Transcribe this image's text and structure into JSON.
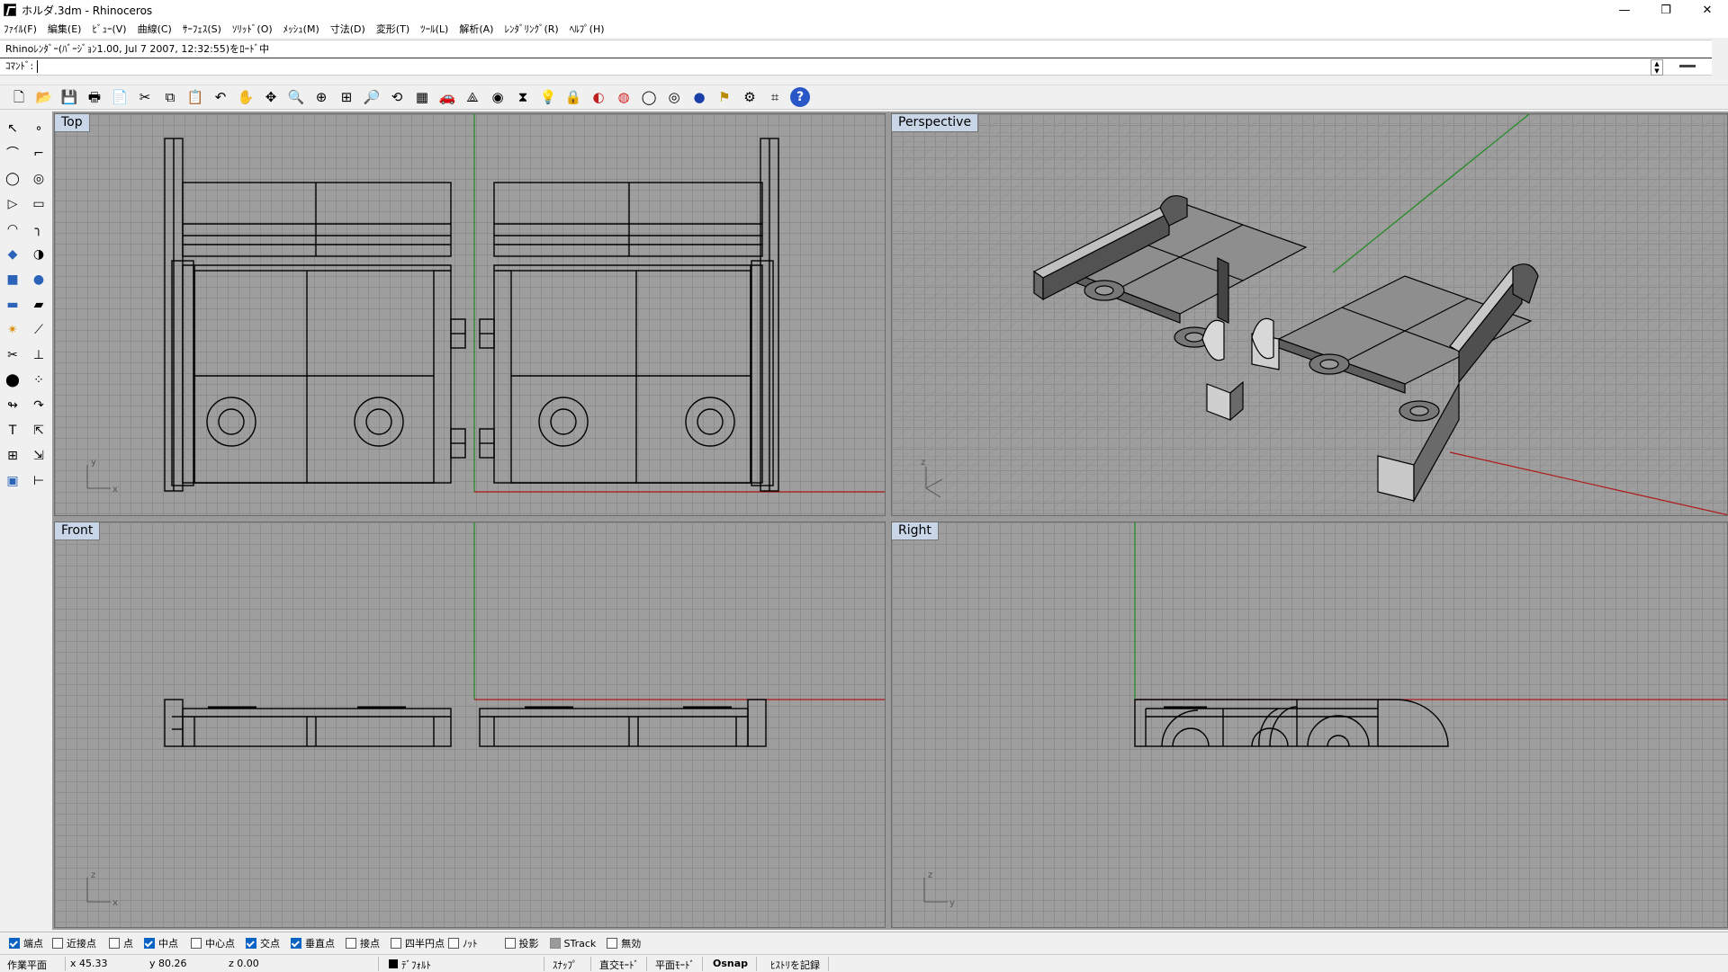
{
  "window": {
    "title": "ホルダ.3dm - Rhinoceros",
    "controls": [
      "—",
      "❐",
      "✕"
    ]
  },
  "menu": [
    "ﾌｧｲﾙ(F)",
    "編集(E)",
    "ﾋﾞｭｰ(V)",
    "曲線(C)",
    "ｻｰﾌｪｽ(S)",
    "ｿﾘｯﾄﾞ(O)",
    "ﾒｯｼｭ(M)",
    "寸法(D)",
    "変形(T)",
    "ﾂｰﾙ(L)",
    "解析(A)",
    "ﾚﾝﾀﾞﾘﾝｸﾞ(R)",
    "ﾍﾙﾌﾟ(H)"
  ],
  "command": {
    "history": "Rhinoﾚﾝﾀﾞｰ(ﾊﾞｰｼﾞｮﾝ1.00, Jul  7 2007, 12:32:55)をﾛｰﾄﾞ中",
    "prompt": "ｺﾏﾝﾄﾞ:"
  },
  "toolbar": {
    "icons": [
      "new-file-icon",
      "open-folder-icon",
      "save-icon",
      "print-icon",
      "import-icon",
      "cut-icon",
      "copy-icon",
      "paste-icon",
      "undo-icon",
      "pan-hand-icon",
      "rotate-view-icon",
      "zoom-icon",
      "zoom-window-icon",
      "zoom-extents-icon",
      "zoom-selected-icon",
      "undo-view-icon",
      "four-viewports-icon",
      "car-render-icon",
      "wireframe-icon",
      "object-properties-icon",
      "layer-icon",
      "light-icon",
      "lock-icon",
      "shade-icon",
      "color-wheel-icon",
      "sphere-wire-icon",
      "sphere-mesh-icon",
      "render-sphere-icon",
      "flag-icon",
      "options-gear-icon",
      "grid-snap-icon",
      "help-icon"
    ],
    "glyphs": [
      "🗋",
      "📂",
      "💾",
      "🖶",
      "📄",
      "✂",
      "⧉",
      "📋",
      "↶",
      "✋",
      "✥",
      "🔍",
      "⊕",
      "⊞",
      "🔎",
      "⟲",
      "▦",
      "🚗",
      "⟁",
      "◉",
      "⧗",
      "💡",
      "🔒",
      "◐",
      "◍",
      "◯",
      "◎",
      "●",
      "⚑",
      "⚙",
      "⌗",
      "?"
    ]
  },
  "sidebar": {
    "icons": [
      "select-arrow-icon",
      "point-icon",
      "polyline-icon",
      "control-points-icon",
      "circle-icon",
      "ellipse-icon",
      "polygon-icon",
      "rectangle-icon",
      "arc-icon",
      "fillet-curve-icon",
      "surface-icon",
      "revolve-icon",
      "box-icon",
      "boolean-icon",
      "cylinder-icon",
      "extrude-icon",
      "explode-icon",
      "blend-icon",
      "trim-icon",
      "split-icon",
      "join-icon",
      "group-icon",
      "offset-icon",
      "curve-tool-icon",
      "text-icon",
      "move-icon",
      "array-icon",
      "scale-icon",
      "block-icon",
      "dimension-icon"
    ],
    "glyphs": [
      "↖",
      "∘",
      "⌒",
      "⌐",
      "◯",
      "◎",
      "▷",
      "▭",
      "◠",
      "╮",
      "◆",
      "◑",
      "■",
      "●",
      "▬",
      "▰",
      "✴",
      "⟋",
      "✂",
      "⊥",
      "⬤",
      "⁘",
      "↬",
      "↷",
      "T",
      "⇱",
      "⊞",
      "⇲",
      "▣",
      "⊢"
    ]
  },
  "viewports": [
    {
      "name": "Top",
      "axis_h": "x",
      "axis_v": "y"
    },
    {
      "name": "Perspective",
      "axis_h": "",
      "axis_v": "z"
    },
    {
      "name": "Front",
      "axis_h": "x",
      "axis_v": "z"
    },
    {
      "name": "Right",
      "axis_h": "y",
      "axis_v": "z"
    }
  ],
  "osnap": [
    {
      "label": "端点",
      "checked": true
    },
    {
      "label": "近接点",
      "checked": false
    },
    {
      "label": "点",
      "checked": false
    },
    {
      "label": "中点",
      "checked": true
    },
    {
      "label": "中心点",
      "checked": false
    },
    {
      "label": "交点",
      "checked": true
    },
    {
      "label": "垂直点",
      "checked": true
    },
    {
      "label": "接点",
      "checked": false
    },
    {
      "label": "四半円点",
      "checked": false
    },
    {
      "label": "ﾉｯﾄ",
      "checked": false
    },
    {
      "label": "投影",
      "checked": false
    },
    {
      "label": "STrack",
      "checked": "gray"
    },
    {
      "label": "無効",
      "checked": false
    }
  ],
  "status": {
    "cplane": "作業平面",
    "x": "x 45.33",
    "y": "y 80.26",
    "z": "z 0.00",
    "layer": "ﾃﾞﾌｫﾙﾄ",
    "snap": "ｽﾅｯﾌﾟ",
    "ortho": "直交ﾓｰﾄﾞ",
    "planar": "平面ﾓｰﾄﾞ",
    "osnap": "Osnap",
    "history": "ﾋｽﾄﾘを記録"
  }
}
